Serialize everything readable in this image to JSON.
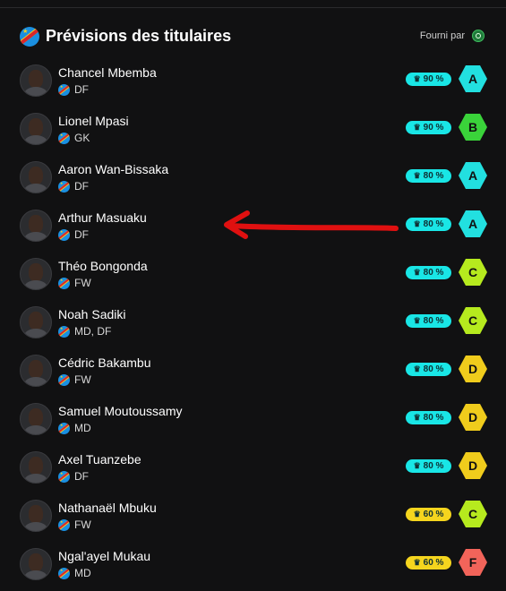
{
  "header": {
    "title": "Prévisions des titulaires",
    "provided_by": "Fourni par",
    "provider_icon": "provider-logo-icon"
  },
  "colors": {
    "background": "#111112",
    "pct_cyan": "#19e6e6",
    "pct_yellow": "#f5d51e",
    "grade_A": "#22e0e0",
    "grade_B": "#3ad33a",
    "grade_C": "#b6ea1e",
    "grade_D": "#f0cc1c",
    "grade_F": "#f2645a",
    "annotation_arrow": "#e01010"
  },
  "players": [
    {
      "name": "Chancel Mbemba",
      "pos": "DF",
      "pct": "90 %",
      "grade": "A",
      "pct_color": "cyan"
    },
    {
      "name": "Lionel Mpasi",
      "pos": "GK",
      "pct": "90 %",
      "grade": "B",
      "pct_color": "cyan"
    },
    {
      "name": "Aaron Wan-Bissaka",
      "pos": "DF",
      "pct": "80 %",
      "grade": "A",
      "pct_color": "cyan"
    },
    {
      "name": "Arthur Masuaku",
      "pos": "DF",
      "pct": "80 %",
      "grade": "A",
      "pct_color": "cyan"
    },
    {
      "name": "Théo Bongonda",
      "pos": "FW",
      "pct": "80 %",
      "grade": "C",
      "pct_color": "cyan"
    },
    {
      "name": "Noah Sadiki",
      "pos": "MD, DF",
      "pct": "80 %",
      "grade": "C",
      "pct_color": "cyan"
    },
    {
      "name": "Cédric Bakambu",
      "pos": "FW",
      "pct": "80 %",
      "grade": "D",
      "pct_color": "cyan"
    },
    {
      "name": "Samuel Moutoussamy",
      "pos": "MD",
      "pct": "80 %",
      "grade": "D",
      "pct_color": "cyan"
    },
    {
      "name": "Axel Tuanzebe",
      "pos": "DF",
      "pct": "80 %",
      "grade": "D",
      "pct_color": "cyan"
    },
    {
      "name": "Nathanaël Mbuku",
      "pos": "FW",
      "pct": "60 %",
      "grade": "C",
      "pct_color": "yellow"
    },
    {
      "name": "Ngal'ayel Mukau",
      "pos": "MD",
      "pct": "60 %",
      "grade": "F",
      "pct_color": "yellow"
    }
  ]
}
